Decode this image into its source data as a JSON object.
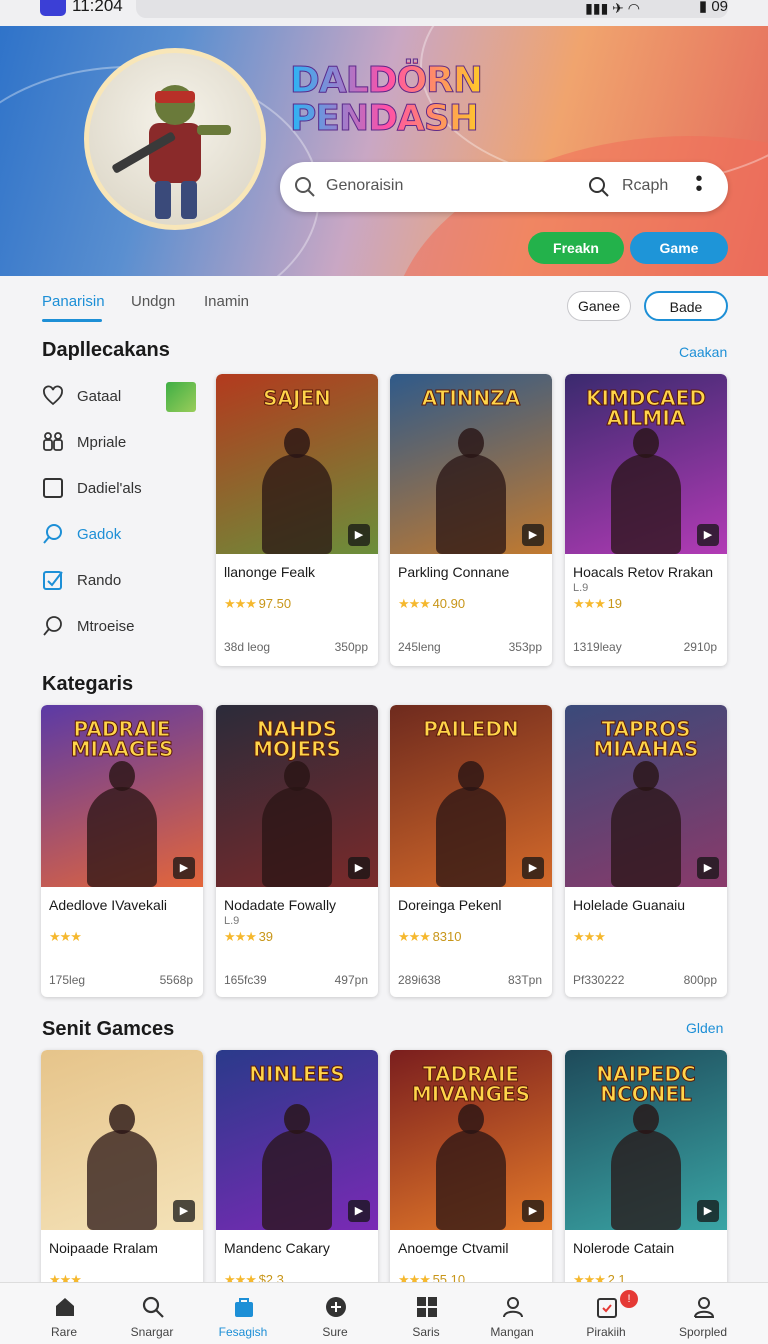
{
  "status_bar": {
    "time": "11:204",
    "battery": "09"
  },
  "hero": {
    "logo_line1": "DALDÖRN",
    "logo_line2": "PENDASH",
    "search_placeholder": "Genoraisin",
    "search_action": "Rcaph",
    "primary_button": "Freakn",
    "secondary_button": "Game"
  },
  "tabs": [
    {
      "label": "Panarisin",
      "active": true
    },
    {
      "label": "Undgn"
    },
    {
      "label": "Inamin"
    }
  ],
  "chips": {
    "first": "Ganee",
    "second": "Bade"
  },
  "featured": {
    "title": "Dapllecakans",
    "link": "Caakan"
  },
  "sidebar": [
    {
      "label": "Gataal",
      "icon": "heart-icon"
    },
    {
      "label": "Mpriale",
      "icon": "people-icon"
    },
    {
      "label": "Dadiel'als",
      "icon": "square-icon"
    },
    {
      "label": "Gadok",
      "icon": "search-icon",
      "active": true
    },
    {
      "label": "Rando",
      "icon": "checkbox-icon"
    },
    {
      "label": "Mtroeise",
      "icon": "search-icon"
    }
  ],
  "featured_cards": [
    {
      "art_title": "SAJEN",
      "name": "llanonge Fealk",
      "rating": "97.50",
      "meta_left": "38d leog",
      "meta_right": "350pp",
      "colors": [
        "#b33a1e",
        "#6b8f3b"
      ]
    },
    {
      "art_title": "ATINNZA",
      "name": "Parkling Connane",
      "rating": "40.90",
      "meta_left": "245leng",
      "meta_right": "353pp",
      "colors": [
        "#2f5a8a",
        "#c27a2f"
      ]
    },
    {
      "art_title": "KIMDCAED AILMIA",
      "name": "Hoacals Retov Rrakan",
      "sub": "L.9",
      "rating": "19",
      "meta_left": "1319leay",
      "meta_right": "2910p",
      "colors": [
        "#3a2a6e",
        "#b23bb5"
      ]
    }
  ],
  "categories": {
    "title": "Kategaris"
  },
  "category_cards": [
    {
      "art_title": "PADRAIE MIAAGES",
      "name": "Adedlove IVavekali",
      "rating": "",
      "meta_left": "175leg",
      "meta_right": "5568p",
      "colors": [
        "#5b3aa6",
        "#e4663a"
      ]
    },
    {
      "art_title": "NAHDS MOJERS",
      "name": "Nodadate Fowally",
      "sub": "L.9",
      "rating": "39",
      "meta_left": "165fc39",
      "meta_right": "497pn",
      "colors": [
        "#2b2b3a",
        "#7a2a2a"
      ]
    },
    {
      "art_title": "PAILEDN",
      "name": "Doreinga Pekenl",
      "rating": "8310",
      "meta_left": "289i638",
      "meta_right": "83Tpn",
      "colors": [
        "#6e2a1e",
        "#d46a2a"
      ]
    },
    {
      "art_title": "TAPROS MIAAHAS",
      "name": "Holelade Guanaiu",
      "rating": "",
      "meta_left": "Pf330222",
      "meta_right": "800pp",
      "colors": [
        "#3a4a7a",
        "#8a3a6a"
      ]
    }
  ],
  "senior": {
    "title": "Senit Gamces",
    "link": "Glden"
  },
  "senior_cards": [
    {
      "art_title": "",
      "name": "Noipaade Rralam",
      "rating": "",
      "colors": [
        "#e6c48a",
        "#f4e2b8"
      ]
    },
    {
      "art_title": "NINLEES",
      "name": "Mandenc Cakary",
      "rating": "$2.3",
      "colors": [
        "#2a3a8a",
        "#7a2ab5"
      ]
    },
    {
      "art_title": "TADRAIE MIVANGES",
      "name": "Anoemge Ctvamil",
      "rating": "55.10",
      "colors": [
        "#7a1e1e",
        "#e47a2a"
      ]
    },
    {
      "art_title": "NAIPEDC NCONEL",
      "name": "Nolerode Catain",
      "rating": "2.1",
      "colors": [
        "#1e4a5a",
        "#3aa5a5"
      ]
    }
  ],
  "bottom_nav": [
    {
      "label": "Rare",
      "icon": "home-icon"
    },
    {
      "label": "Snargar",
      "icon": "search-icon"
    },
    {
      "label": "Fesagish",
      "icon": "bag-icon",
      "active": true
    },
    {
      "label": "Sure",
      "icon": "compass-icon"
    },
    {
      "label": "Saris",
      "icon": "grid-icon"
    },
    {
      "label": "Mangan",
      "icon": "user-icon"
    },
    {
      "label": "Pirakiih",
      "icon": "calendar-icon",
      "badge": "!"
    },
    {
      "label": "Sporpled",
      "icon": "profile-icon"
    }
  ]
}
